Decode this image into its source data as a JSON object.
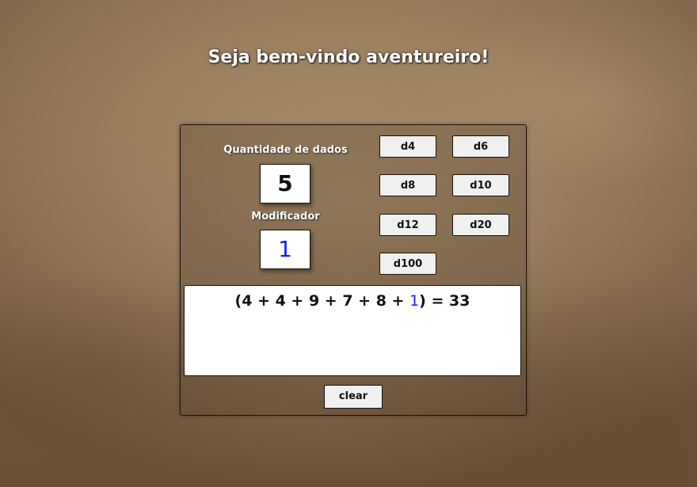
{
  "title": "Seja bem-vindo aventureiro!",
  "dice_quantity": {
    "label": "Quantidade de dados",
    "value": "5"
  },
  "modifier": {
    "label": "Modificador",
    "value": "1"
  },
  "dice_buttons": [
    "d4",
    "d6",
    "d8",
    "d10",
    "d12",
    "d20",
    "d100"
  ],
  "result": {
    "prefix": "(4 + 4 + 9 + 7 + 8 + ",
    "modifier": "1",
    "suffix": ") = 33"
  },
  "clear_label": "clear",
  "colors": {
    "modifier_text": "#1a1aff",
    "panel_border": "#1a120a",
    "button_bg": "#f0f0f0"
  }
}
